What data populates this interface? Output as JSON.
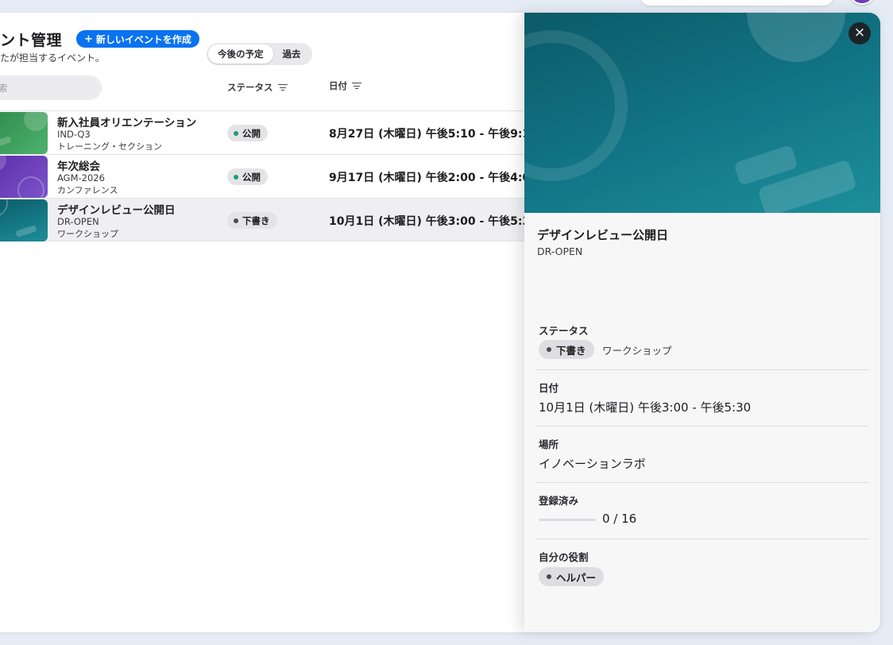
{
  "header": {
    "title": "ント管理",
    "create_button": "新しいイベントを作成",
    "subtitle": "たが担当するイベント。"
  },
  "segments": [
    {
      "label": "今後の予定",
      "active": true
    },
    {
      "label": "過去",
      "active": false
    }
  ],
  "search": {
    "placeholder": "索"
  },
  "columns": {
    "status": "ステータス",
    "date": "日付"
  },
  "rows": [
    {
      "name": "新入社員オリエンテーション",
      "code": "IND-Q3",
      "type": "トレーニング・セクション",
      "status": "公開",
      "date": "8月27日 (木曜日) 午後5:10 - 午後9:1",
      "thumb_color": "#3f9a5a",
      "status_color": "#1a9e6e"
    },
    {
      "name": "年次総会",
      "code": "AGM-2026",
      "type": "カンファレンス",
      "status": "公開",
      "date": "9月17日 (木曜日) 午後2:00 - 午後4:0",
      "thumb_color": "#6a3fb8",
      "status_color": "#1a9e6e"
    },
    {
      "name": "デザインレビュー公開日",
      "code": "DR-OPEN",
      "type": "ワークショップ",
      "status": "下書き",
      "date": "10月1日 (木曜日) 午後3:00 - 午後5:3",
      "thumb_color": "#127687",
      "status_color": "#4a4a4e"
    }
  ],
  "detail": {
    "title": "デザインレビュー公開日",
    "code": "DR-OPEN",
    "status_label": "ステータス",
    "status_value": "下書き",
    "status_type": "ワークショップ",
    "date_label": "日付",
    "date_value": "10月1日 (木曜日) 午後3:00 - 午後5:30",
    "location_label": "場所",
    "location_value": "イノベーションラボ",
    "registered_label": "登録済み",
    "registered_value": "0 / 16",
    "registered_fraction": 0,
    "role_label": "自分の役割",
    "role_value": "ヘルパー",
    "close_icon": "close-icon"
  },
  "colors": {
    "accent": "#0a72f0",
    "published": "#1a9e6e",
    "draft": "#4a4a4e"
  }
}
